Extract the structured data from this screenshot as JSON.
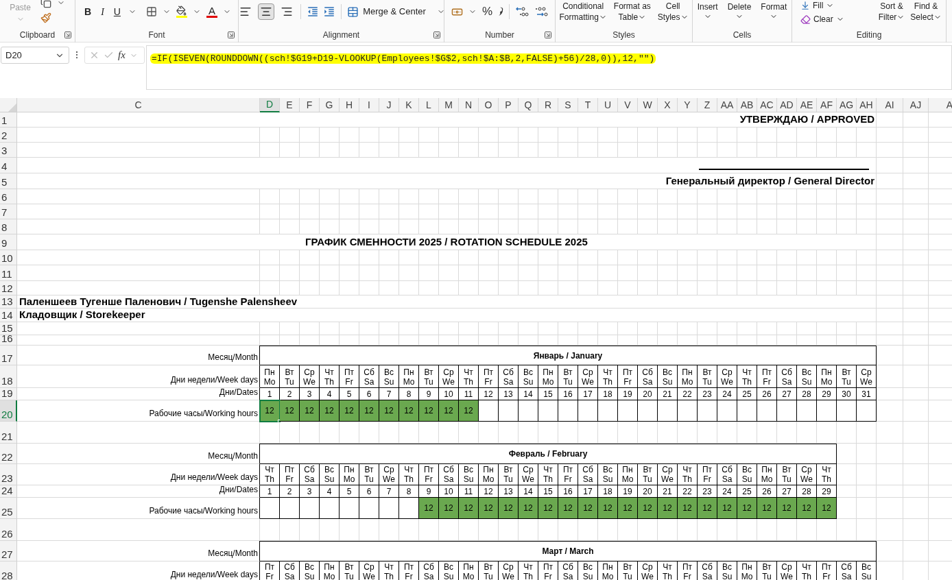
{
  "ribbon": {
    "clipboard": {
      "label": "Clipboard",
      "launcher": true,
      "paste": {
        "label": "Paste",
        "disabled": true
      }
    },
    "font": {
      "label": "Font",
      "launcher": true,
      "bold": "B",
      "italic": "I",
      "underline": "U",
      "font_color": "A"
    },
    "alignment": {
      "label": "Alignment",
      "launcher": true,
      "align_buttons": [
        {
          "kind": "left",
          "selected": false
        },
        {
          "kind": "center",
          "selected": true
        },
        {
          "kind": "right",
          "selected": false
        }
      ],
      "merge": "Merge & Center"
    },
    "number": {
      "label": "Number",
      "launcher": true,
      "percent": "%"
    },
    "styles": {
      "label": "Styles",
      "launcher": false,
      "buttons": [
        {
          "lines": [
            "Conditional",
            "Formatting"
          ]
        },
        {
          "lines": [
            "Format as",
            "Table"
          ]
        },
        {
          "lines": [
            "Cell",
            "Styles"
          ]
        }
      ]
    },
    "cells": {
      "label": "Cells",
      "launcher": false,
      "buttons": [
        "Insert",
        "Delete",
        "Format"
      ]
    },
    "editing": {
      "label": "Editing",
      "launcher": false,
      "fill": "Fill",
      "clear": "Clear",
      "buttons": [
        {
          "lines": [
            "Sort &",
            "Filter"
          ]
        },
        {
          "lines": [
            "Find &",
            "Select"
          ]
        }
      ]
    }
  },
  "formula_bar": {
    "name_box": "D20",
    "fx": "fx",
    "formula": "=IF(ISEVEN(ROUNDDOWN((sch!$G19+D19-VLOOKUP(Employees!$G$2,sch!$A:$B,2,FALSE)+56)/28,0)),12,\"\")"
  },
  "sheet": {
    "columns": [
      {
        "label": "C",
        "selected": false
      },
      {
        "label": "D",
        "selected": true
      },
      {
        "label": "E",
        "selected": false
      },
      {
        "label": "F",
        "selected": false
      },
      {
        "label": "G",
        "selected": false
      },
      {
        "label": "H",
        "selected": false
      },
      {
        "label": "I",
        "selected": false
      },
      {
        "label": "J",
        "selected": false
      },
      {
        "label": "K",
        "selected": false
      },
      {
        "label": "L",
        "selected": false
      },
      {
        "label": "M",
        "selected": false
      },
      {
        "label": "N",
        "selected": false
      },
      {
        "label": "O",
        "selected": false
      },
      {
        "label": "P",
        "selected": false
      },
      {
        "label": "Q",
        "selected": false
      },
      {
        "label": "R",
        "selected": false
      },
      {
        "label": "S",
        "selected": false
      },
      {
        "label": "T",
        "selected": false
      },
      {
        "label": "U",
        "selected": false
      },
      {
        "label": "V",
        "selected": false
      },
      {
        "label": "W",
        "selected": false
      },
      {
        "label": "X",
        "selected": false
      },
      {
        "label": "Y",
        "selected": false
      },
      {
        "label": "Z",
        "selected": false
      },
      {
        "label": "AA",
        "selected": false
      },
      {
        "label": "AB",
        "selected": false
      },
      {
        "label": "AC",
        "selected": false
      },
      {
        "label": "AD",
        "selected": false
      },
      {
        "label": "AE",
        "selected": false
      },
      {
        "label": "AF",
        "selected": false
      },
      {
        "label": "AG",
        "selected": false
      },
      {
        "label": "AH",
        "selected": false
      },
      {
        "label": "AI",
        "selected": false
      },
      {
        "label": "AJ",
        "selected": false
      },
      {
        "label": "A",
        "selected": false
      }
    ],
    "row_numbers": [
      {
        "label": "1",
        "selected": false
      },
      {
        "label": "2",
        "selected": false
      },
      {
        "label": "3",
        "selected": false
      },
      {
        "label": "4",
        "selected": false
      },
      {
        "label": "5",
        "selected": false
      },
      {
        "label": "6",
        "selected": false
      },
      {
        "label": "7",
        "selected": false
      },
      {
        "label": "8",
        "selected": false
      },
      {
        "label": "9",
        "selected": false
      },
      {
        "label": "10",
        "selected": false
      },
      {
        "label": "11",
        "selected": false
      },
      {
        "label": "12",
        "selected": false
      },
      {
        "label": "13",
        "selected": false
      },
      {
        "label": "14",
        "selected": false
      },
      {
        "label": "15",
        "selected": false
      },
      {
        "label": "16",
        "selected": false
      },
      {
        "label": "17",
        "selected": false
      },
      {
        "label": "18",
        "selected": false
      },
      {
        "label": "19",
        "selected": false
      },
      {
        "label": "20",
        "selected": true
      },
      {
        "label": "21",
        "selected": false
      },
      {
        "label": "22",
        "selected": false
      },
      {
        "label": "23",
        "selected": false
      },
      {
        "label": "24",
        "selected": false
      },
      {
        "label": "25",
        "selected": false
      },
      {
        "label": "26",
        "selected": false
      },
      {
        "label": "27",
        "selected": false
      },
      {
        "label": "28",
        "selected": false
      }
    ],
    "approved": "УТВЕРЖДАЮ / APPROVED",
    "signatory": "Генеральный директор / General Director",
    "title": "ГРАФИК СМЕННОСТИ 2025 / ROTATION SCHEDULE 2025",
    "employee_name": "Паленшеев Тугенше Паленович / Tugenshe Palensheev",
    "position": "Кладовщик / Storekeeper",
    "months": [
      {
        "title": "Январь / January",
        "labels": {
          "month": "Месяц/Month",
          "weekdays": "Дни недели/Week days",
          "dates": "Дни/Dates",
          "hours": "Рабочие часы/Working hours"
        },
        "days": [
          {
            "ru": "Пн",
            "en": "Mo",
            "date": "1",
            "hours": "12",
            "selected": true
          },
          {
            "ru": "Вт",
            "en": "Tu",
            "date": "2",
            "hours": "12",
            "selected": false
          },
          {
            "ru": "Ср",
            "en": "We",
            "date": "3",
            "hours": "12",
            "selected": false
          },
          {
            "ru": "Чт",
            "en": "Th",
            "date": "4",
            "hours": "12",
            "selected": false
          },
          {
            "ru": "Пт",
            "en": "Fr",
            "date": "5",
            "hours": "12",
            "selected": false
          },
          {
            "ru": "Сб",
            "en": "Sa",
            "date": "6",
            "hours": "12",
            "selected": false
          },
          {
            "ru": "Вс",
            "en": "Su",
            "date": "7",
            "hours": "12",
            "selected": false
          },
          {
            "ru": "Пн",
            "en": "Mo",
            "date": "8",
            "hours": "12",
            "selected": false
          },
          {
            "ru": "Вт",
            "en": "Tu",
            "date": "9",
            "hours": "12",
            "selected": false
          },
          {
            "ru": "Ср",
            "en": "We",
            "date": "10",
            "hours": "12",
            "selected": false
          },
          {
            "ru": "Чт",
            "en": "Th",
            "date": "11",
            "hours": "12",
            "selected": false
          },
          {
            "ru": "Пт",
            "en": "Fr",
            "date": "12",
            "selected": false
          },
          {
            "ru": "Сб",
            "en": "Sa",
            "date": "13",
            "selected": false
          },
          {
            "ru": "Вс",
            "en": "Su",
            "date": "14",
            "selected": false
          },
          {
            "ru": "Пн",
            "en": "Mo",
            "date": "15",
            "selected": false
          },
          {
            "ru": "Вт",
            "en": "Tu",
            "date": "16",
            "selected": false
          },
          {
            "ru": "Ср",
            "en": "We",
            "date": "17",
            "selected": false
          },
          {
            "ru": "Чт",
            "en": "Th",
            "date": "18",
            "selected": false
          },
          {
            "ru": "Пт",
            "en": "Fr",
            "date": "19",
            "selected": false
          },
          {
            "ru": "Сб",
            "en": "Sa",
            "date": "20",
            "selected": false
          },
          {
            "ru": "Вс",
            "en": "Su",
            "date": "21",
            "selected": false
          },
          {
            "ru": "Пн",
            "en": "Mo",
            "date": "22",
            "selected": false
          },
          {
            "ru": "Вт",
            "en": "Tu",
            "date": "23",
            "selected": false
          },
          {
            "ru": "Ср",
            "en": "We",
            "date": "24",
            "selected": false
          },
          {
            "ru": "Чт",
            "en": "Th",
            "date": "25",
            "selected": false
          },
          {
            "ru": "Пт",
            "en": "Fr",
            "date": "26",
            "selected": false
          },
          {
            "ru": "Сб",
            "en": "Sa",
            "date": "27",
            "selected": false
          },
          {
            "ru": "Вс",
            "en": "Su",
            "date": "28",
            "selected": false
          },
          {
            "ru": "Пн",
            "en": "Mo",
            "date": "29",
            "selected": false
          },
          {
            "ru": "Вт",
            "en": "Tu",
            "date": "30",
            "selected": false
          },
          {
            "ru": "Ср",
            "en": "We",
            "date": "31",
            "selected": false
          }
        ]
      },
      {
        "title": "Февраль / February",
        "labels": {
          "month": "Месяц/Month",
          "weekdays": "Дни недели/Week days",
          "dates": "Дни/Dates",
          "hours": "Рабочие часы/Working hours"
        },
        "days": [
          {
            "ru": "Чт",
            "en": "Th",
            "date": "1",
            "selected": false
          },
          {
            "ru": "Пт",
            "en": "Fr",
            "date": "2",
            "selected": false
          },
          {
            "ru": "Сб",
            "en": "Sa",
            "date": "3",
            "selected": false
          },
          {
            "ru": "Вс",
            "en": "Su",
            "date": "4",
            "selected": false
          },
          {
            "ru": "Пн",
            "en": "Mo",
            "date": "5",
            "selected": false
          },
          {
            "ru": "Вт",
            "en": "Tu",
            "date": "6",
            "selected": false
          },
          {
            "ru": "Ср",
            "en": "We",
            "date": "7",
            "selected": false
          },
          {
            "ru": "Чт",
            "en": "Th",
            "date": "8",
            "selected": false
          },
          {
            "ru": "Пт",
            "en": "Fr",
            "date": "9",
            "hours": "12",
            "selected": false
          },
          {
            "ru": "Сб",
            "en": "Sa",
            "date": "10",
            "hours": "12",
            "selected": false
          },
          {
            "ru": "Вс",
            "en": "Su",
            "date": "11",
            "hours": "12",
            "selected": false
          },
          {
            "ru": "Пн",
            "en": "Mo",
            "date": "12",
            "hours": "12",
            "selected": false
          },
          {
            "ru": "Вт",
            "en": "Tu",
            "date": "13",
            "hours": "12",
            "selected": false
          },
          {
            "ru": "Ср",
            "en": "We",
            "date": "14",
            "hours": "12",
            "selected": false
          },
          {
            "ru": "Чт",
            "en": "Th",
            "date": "15",
            "hours": "12",
            "selected": false
          },
          {
            "ru": "Пт",
            "en": "Fr",
            "date": "16",
            "hours": "12",
            "selected": false
          },
          {
            "ru": "Сб",
            "en": "Sa",
            "date": "17",
            "hours": "12",
            "selected": false
          },
          {
            "ru": "Вс",
            "en": "Su",
            "date": "18",
            "hours": "12",
            "selected": false
          },
          {
            "ru": "Пн",
            "en": "Mo",
            "date": "19",
            "hours": "12",
            "selected": false
          },
          {
            "ru": "Вт",
            "en": "Tu",
            "date": "20",
            "hours": "12",
            "selected": false
          },
          {
            "ru": "Ср",
            "en": "We",
            "date": "21",
            "hours": "12",
            "selected": false
          },
          {
            "ru": "Чт",
            "en": "Th",
            "date": "22",
            "hours": "12",
            "selected": false
          },
          {
            "ru": "Пт",
            "en": "Fr",
            "date": "23",
            "hours": "12",
            "selected": false
          },
          {
            "ru": "Сб",
            "en": "Sa",
            "date": "24",
            "hours": "12",
            "selected": false
          },
          {
            "ru": "Вс",
            "en": "Su",
            "date": "25",
            "hours": "12",
            "selected": false
          },
          {
            "ru": "Пн",
            "en": "Mo",
            "date": "26",
            "hours": "12",
            "selected": false
          },
          {
            "ru": "Вт",
            "en": "Tu",
            "date": "27",
            "hours": "12",
            "selected": false
          },
          {
            "ru": "Ср",
            "en": "We",
            "date": "28",
            "hours": "12",
            "selected": false
          },
          {
            "ru": "Чт",
            "en": "Th",
            "date": "29",
            "hours": "12",
            "selected": false
          }
        ]
      },
      {
        "title": "Март / March",
        "labels": {
          "month": "Месяц/Month",
          "weekdays": "Дни недели/Week days"
        },
        "days": [
          {
            "ru": "Пт",
            "en": "Fr"
          },
          {
            "ru": "Сб",
            "en": "Sa"
          },
          {
            "ru": "Вс",
            "en": "Su"
          },
          {
            "ru": "Пн",
            "en": "Mo"
          },
          {
            "ru": "Вт",
            "en": "Tu"
          },
          {
            "ru": "Ср",
            "en": "We"
          },
          {
            "ru": "Чт",
            "en": "Th"
          },
          {
            "ru": "Пт",
            "en": "Fr"
          },
          {
            "ru": "Сб",
            "en": "Sa"
          },
          {
            "ru": "Вс",
            "en": "Su"
          },
          {
            "ru": "Пн",
            "en": "Mo"
          },
          {
            "ru": "Вт",
            "en": "Tu"
          },
          {
            "ru": "Ср",
            "en": "We"
          },
          {
            "ru": "Чт",
            "en": "Th"
          },
          {
            "ru": "Пт",
            "en": "Fr"
          },
          {
            "ru": "Сб",
            "en": "Sa"
          },
          {
            "ru": "Вс",
            "en": "Su"
          },
          {
            "ru": "Пн",
            "en": "Mo"
          },
          {
            "ru": "Вт",
            "en": "Tu"
          },
          {
            "ru": "Ср",
            "en": "We"
          },
          {
            "ru": "Чт",
            "en": "Th"
          },
          {
            "ru": "Пт",
            "en": "Fr"
          },
          {
            "ru": "Сб",
            "en": "Sa"
          },
          {
            "ru": "Вс",
            "en": "Su"
          },
          {
            "ru": "Пн",
            "en": "Mo"
          },
          {
            "ru": "Вт",
            "en": "Tu"
          },
          {
            "ru": "Ср",
            "en": "We"
          },
          {
            "ru": "Чт",
            "en": "Th"
          },
          {
            "ru": "Пт",
            "en": "Fr"
          },
          {
            "ru": "Сб",
            "en": "Sa"
          },
          {
            "ru": "Вс",
            "en": "Su"
          }
        ]
      }
    ]
  }
}
